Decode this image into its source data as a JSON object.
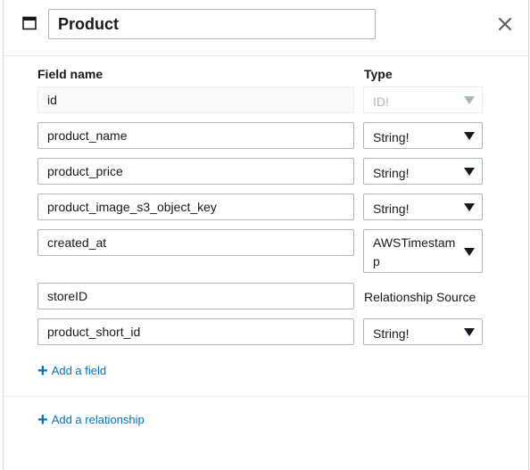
{
  "header": {
    "model_name": "Product"
  },
  "columns": {
    "field_name": "Field name",
    "type": "Type"
  },
  "fields": [
    {
      "name": "id",
      "type": "ID!"
    },
    {
      "name": "product_name",
      "type": "String!"
    },
    {
      "name": "product_price",
      "type": "String!"
    },
    {
      "name": "product_image_s3_object_key",
      "type": "String!"
    },
    {
      "name": "created_at",
      "type": "AWSTimestamp"
    },
    {
      "name": "storeID",
      "type": "Relationship Source"
    },
    {
      "name": "product_short_id",
      "type": "String!"
    }
  ],
  "actions": {
    "add_field": "Add a field",
    "add_relationship": "Add a relationship"
  },
  "colors": {
    "link": "#0073bb",
    "border": "#aab7b8",
    "text": "#16191f"
  }
}
